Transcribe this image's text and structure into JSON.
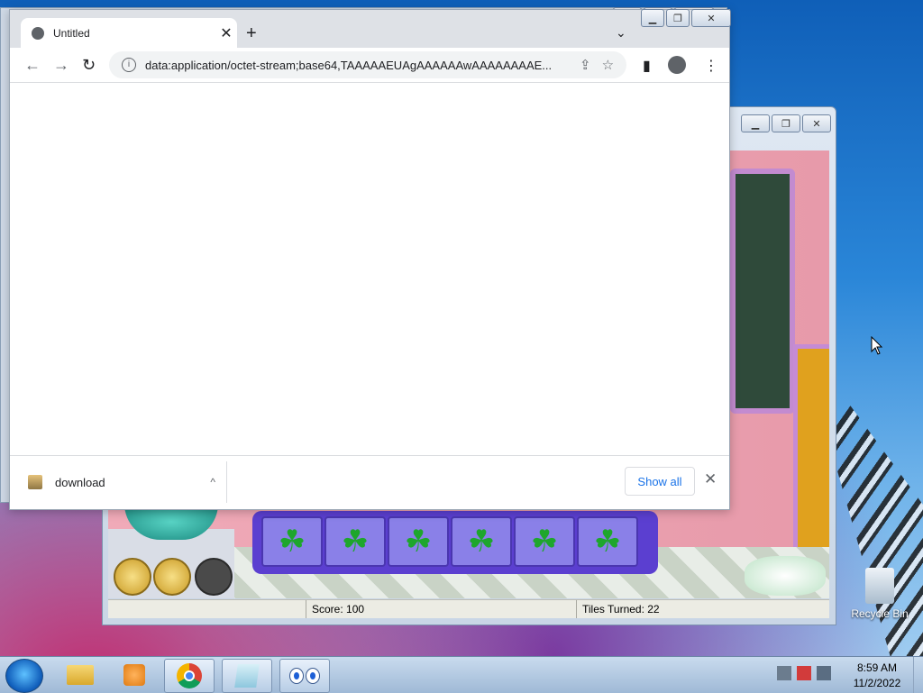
{
  "chrome": {
    "tab_title": "Untitled",
    "tab_close": "✕",
    "new_tab": "+",
    "tab_menu": "⌄",
    "url": "data:application/octet-stream;base64,TAAAAAEUAgAAAAAAwAAAAAAAAE...",
    "download_item": "download",
    "download_chevron": "^",
    "show_all": "Show all",
    "download_close": "✕"
  },
  "game": {
    "score": "Score: 100",
    "tiles_turned": "Tiles Turned: 22"
  },
  "desktop": {
    "recycle_bin": "Recycle Bin"
  },
  "taskbar": {
    "time": "8:59 AM",
    "date": "11/2/2022"
  },
  "icons": {
    "back": "←",
    "forward": "→",
    "reload": "↻",
    "share": "⇪",
    "star": "☆",
    "sidepanel": "▮",
    "menu": "⋮",
    "clover": "☘"
  },
  "colors": {
    "chrome_tab_strip": "#dee1e6",
    "show_all_text": "#1a73e8",
    "game_wall": "#e79aaa",
    "tile_rack": "#5b3fd0",
    "clover": "#1ea62c"
  }
}
